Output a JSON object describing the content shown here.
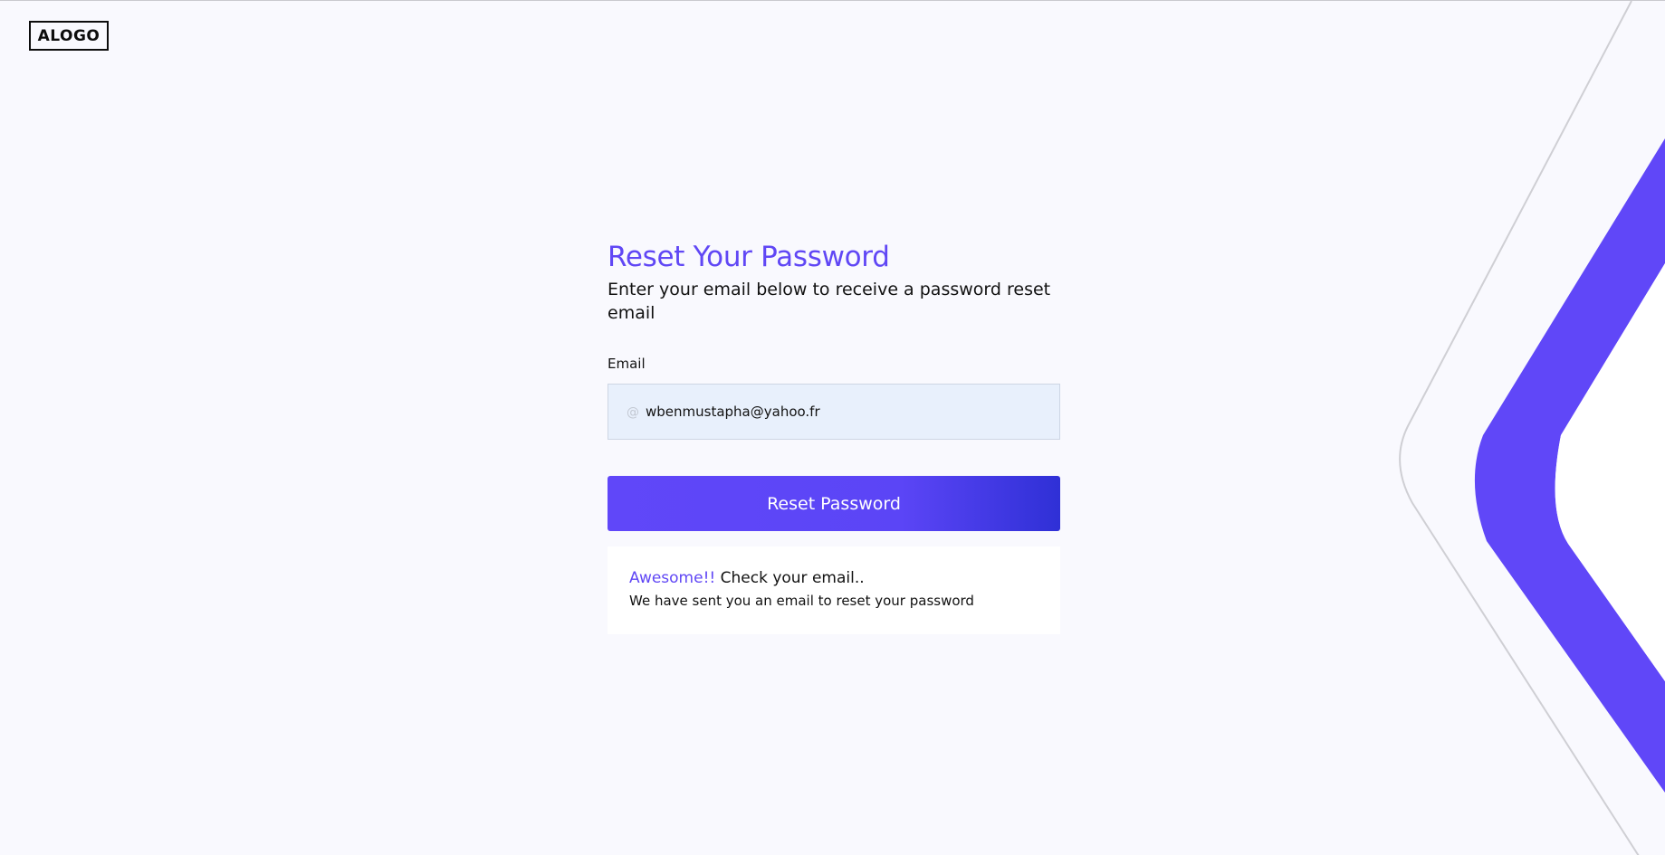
{
  "header": {
    "logo_text": "ALOGO"
  },
  "form": {
    "title": "Reset Your Password",
    "subtitle": "Enter your email below to receive a password reset email",
    "email_label": "Email",
    "email_icon": "@",
    "email_value": "wbenmustapha@yahoo.fr",
    "submit_label": "Reset Password"
  },
  "alert": {
    "accent": "Awesome!!",
    "headline": "Check your email..",
    "message": "We have sent you an email to reset your password"
  },
  "colors": {
    "accent": "#6047f5",
    "button_start": "#6047f9",
    "button_end": "#2f30d6",
    "input_bg": "#e8f0fc",
    "page_bg": "#f9f9fe"
  },
  "icons": {
    "input_icon": "at-icon",
    "decoration": "chevron-decoration"
  }
}
